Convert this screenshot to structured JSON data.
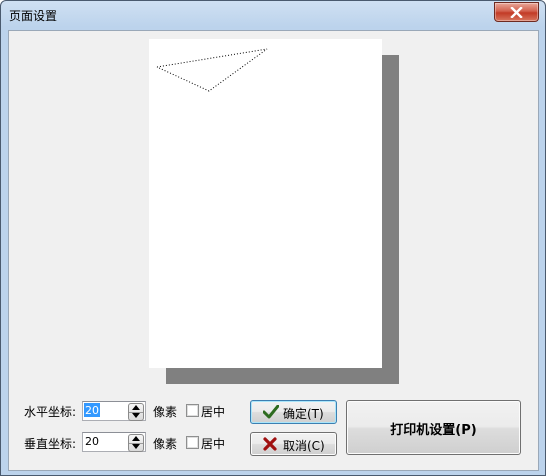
{
  "window": {
    "title": "页面设置"
  },
  "horizontal": {
    "label": "水平坐标:",
    "value": "20",
    "unit": "像素",
    "center_label": "居中",
    "centered": false
  },
  "vertical": {
    "label": "垂直坐标:",
    "value": "20",
    "unit": "像素",
    "center_label": "居中",
    "centered": false
  },
  "buttons": {
    "ok_label": "确定(T)",
    "cancel_label": "取消(C)",
    "printer_label": "打印机设置(P)"
  },
  "colors": {
    "page_shadow": "#808080",
    "dialog_background": "#f0f0f0",
    "close_button": "#c23b26",
    "ok_check": "#2d6b1f",
    "cancel_x": "#a01010",
    "selection": "#3399ff"
  },
  "icons": {
    "close": "close-icon",
    "ok": "checkmark-icon",
    "cancel": "x-icon",
    "spin_up": "arrow-up-icon",
    "spin_down": "arrow-down-icon"
  }
}
